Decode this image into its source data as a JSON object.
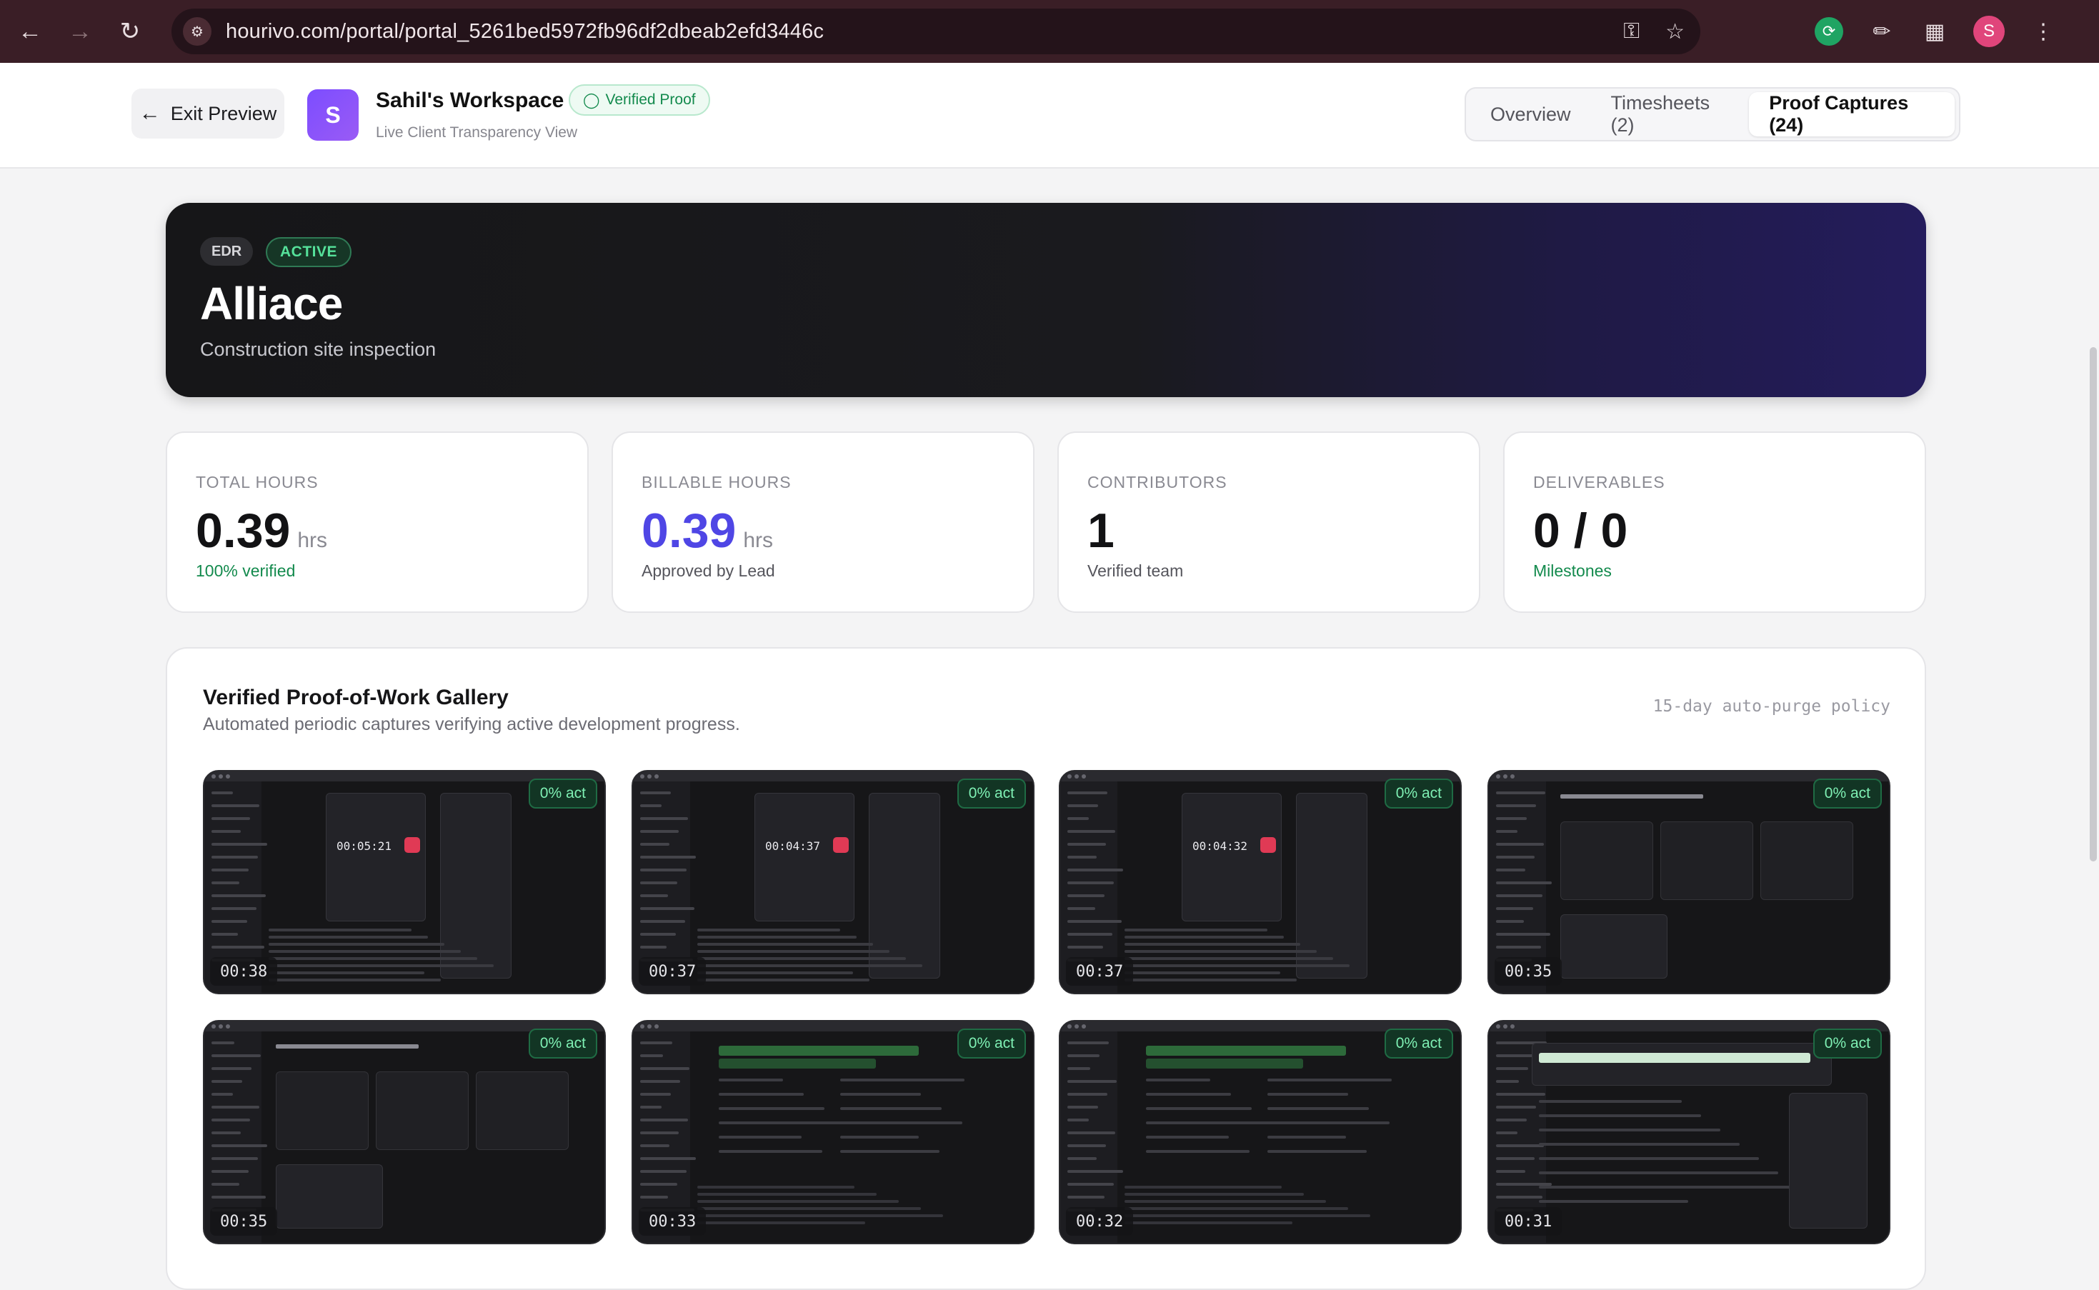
{
  "browser": {
    "url": "hourivo.com/portal/portal_5261bed5972fb96df2dbeab2efd3446c",
    "profile_initial": "S"
  },
  "header": {
    "exit_label": "Exit Preview",
    "avatar_initial": "S",
    "workspace_name": "Sahil's Workspace",
    "verified_label": "Verified Proof",
    "subtitle": "Live Client Transparency View",
    "tabs": [
      {
        "label": "Overview",
        "active": false
      },
      {
        "label": "Timesheets (2)",
        "active": false
      },
      {
        "label": "Proof Captures (24)",
        "active": true
      }
    ]
  },
  "project": {
    "code": "EDR",
    "status": "ACTIVE",
    "name": "Alliace",
    "description": "Construction site inspection"
  },
  "stats": [
    {
      "label": "TOTAL HOURS",
      "value": "0.39",
      "unit": "hrs",
      "note": "100% verified"
    },
    {
      "label": "BILLABLE HOURS",
      "value": "0.39",
      "unit": "hrs",
      "note": "Approved by Lead"
    },
    {
      "label": "CONTRIBUTORS",
      "value": "1",
      "unit": "",
      "note": "Verified team"
    },
    {
      "label": "DELIVERABLES",
      "value": "0 / 0",
      "unit": "",
      "note": "Milestones"
    }
  ],
  "gallery": {
    "title": "Verified Proof-of-Work Gallery",
    "subtitle": "Automated periodic captures verifying active development progress.",
    "policy": "15-day auto-purge policy",
    "captures": [
      {
        "activity": "0% act",
        "time": "00:38",
        "timer_text": "00:05:21",
        "kind": "timer"
      },
      {
        "activity": "0% act",
        "time": "00:37",
        "timer_text": "00:04:37",
        "kind": "timer"
      },
      {
        "activity": "0% act",
        "time": "00:37",
        "timer_text": "00:04:32",
        "kind": "timer"
      },
      {
        "activity": "0% act",
        "time": "00:35",
        "timer_text": "",
        "kind": "dashboard"
      },
      {
        "activity": "0% act",
        "time": "00:35",
        "timer_text": "",
        "kind": "dashboard"
      },
      {
        "activity": "0% act",
        "time": "00:33",
        "timer_text": "",
        "kind": "editor"
      },
      {
        "activity": "0% act",
        "time": "00:32",
        "timer_text": "",
        "kind": "editor"
      },
      {
        "activity": "0% act",
        "time": "00:31",
        "timer_text": "",
        "kind": "browser"
      }
    ]
  }
}
